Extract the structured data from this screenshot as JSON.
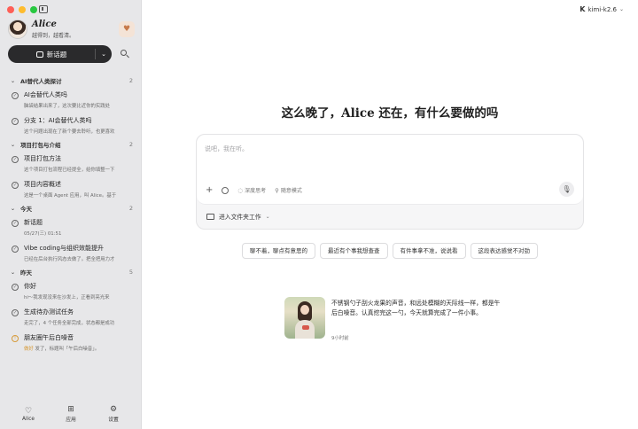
{
  "window": {
    "title": ""
  },
  "profile": {
    "name": "Alice",
    "motto": "越得到，越看清。"
  },
  "sidebar": {
    "new_chat_label": "新话题",
    "groups": [
      {
        "title": "AI替代人类探讨",
        "count": "2",
        "items": [
          {
            "title": "AI会替代人类吗",
            "subtitle": "脑袋结果出来了，这次要比近你的实践处"
          },
          {
            "title": "分支 1：AI会替代人类吗",
            "subtitle": "这个问题出现在了新个要去聆听，也更喜欢"
          }
        ]
      },
      {
        "title": "项目打包与介绍",
        "count": "2",
        "items": [
          {
            "title": "项目打包方法",
            "subtitle": "这个项目打包流程已经提全，给你填整一下"
          },
          {
            "title": "项目内容概述",
            "subtitle": "这是一个桌面 Agent 应用，叫 Alice。基于"
          }
        ]
      },
      {
        "title": "今天",
        "count": "2",
        "items": [
          {
            "title": "新话题",
            "subtitle": "05/27(三) 01:51"
          },
          {
            "title": "Vibe coding与组织效能提升",
            "subtitle": "已经在后台执行风态去做了。把全把用力才"
          }
        ]
      },
      {
        "title": "昨天",
        "count": "5",
        "items": [
          {
            "title": "你好",
            "subtitle": "hi～我发现没来在沙发上，正看到亮光来"
          },
          {
            "title": "生成待办测试任务",
            "subtitle": "走完了，4 个任务全部完成，状态都是成功"
          },
          {
            "title": "朋友圈午后白噪音",
            "subtitle_prefix": "做好",
            "subtitle": " 发了，标题叫「午后白噪音」。"
          }
        ]
      }
    ],
    "bottom_nav": [
      {
        "label": "Alice",
        "icon": "heart-icon"
      },
      {
        "label": "应用",
        "icon": "apps-grid-icon"
      },
      {
        "label": "设置",
        "icon": "gear-icon"
      }
    ]
  },
  "model": {
    "logo": "K",
    "label": "kimi-k2.6"
  },
  "main": {
    "greeting": "这么晚了，Alice 还在，有什么要做的吗",
    "composer": {
      "placeholder": "说吧，我在听。",
      "deep_think_label": "深度思考",
      "follow_mode_label": "随意模式",
      "folder_label": "进入文件夹工作"
    },
    "chips": [
      "聊不着，聊点有意思的",
      "最近有个事我想查查",
      "有件事拿不准，说说看",
      "这段表达感觉不对劲"
    ],
    "card": {
      "text": "不锈钢勺子刮火龙果的声音，和远处模糊的天际线一样，都是午后白噪音。认真挖完这一勺，今天就算完成了一件小事。",
      "time": "9小时前"
    }
  }
}
